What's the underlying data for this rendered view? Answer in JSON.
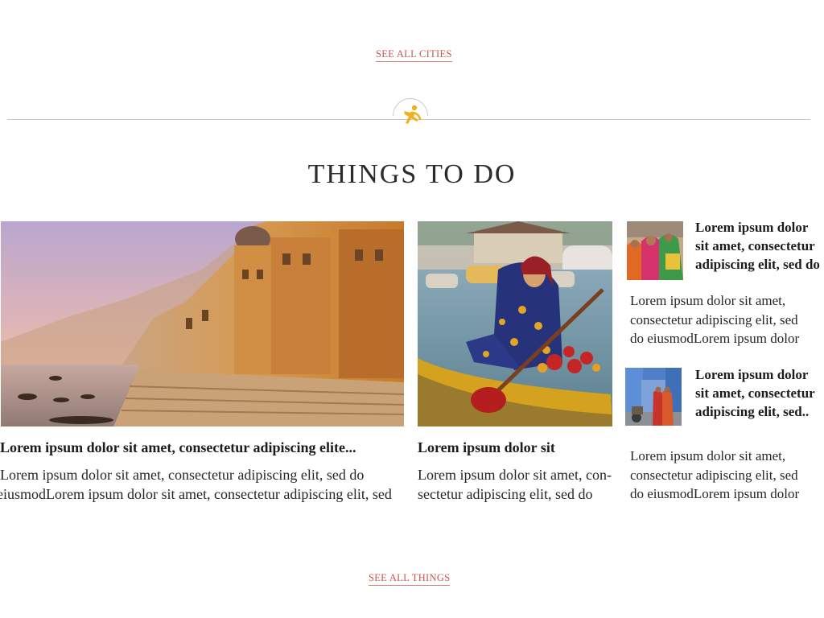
{
  "links": {
    "see_all_cities": "SEE ALL CITIES",
    "see_all_things": "SEE ALL THINGS"
  },
  "section": {
    "title": "THINGS TO DO",
    "emblem_icon": "runner-icon",
    "emblem_color": "#f2b01e"
  },
  "colors": {
    "link": "#c9574f",
    "divider": "#c8c8c8"
  },
  "cards": {
    "featured": {
      "image": "varanasi-ghats-photo",
      "title": "Lorem ipsum dolor sit amet, consectetur adipiscing elite...",
      "body_line1": "Lorem ipsum dolor sit amet, consectetur adipiscing elit, sed do",
      "body_line2": "eiusmodLorem ipsum dolor sit amet, consectetur adipiscing elit, sed"
    },
    "middle": {
      "image": "kashmir-boat-woman-photo",
      "title": "Lorem ipsum dolor sit",
      "body_line1": "Lorem ipsum dolor sit amet, con-",
      "body_line2": "sectetur adipiscing elit, sed do"
    },
    "side": [
      {
        "image": "festival-women-photo",
        "title": "Lorem ipsum dolor sit amet, consectetur adipiscing elit, sed do",
        "body_line1": "Lorem ipsum dolor sit amet,",
        "body_line2": "consectetur adipiscing elit, sed",
        "body_line3": "do eiusmodLorem ipsum dolor"
      },
      {
        "image": "blue-city-street-photo",
        "title": "Lorem ipsum dolor sit amet, consectetur adipiscing elit, sed..",
        "body_line1": "Lorem ipsum dolor sit amet,",
        "body_line2": "consectetur adipiscing elit, sed",
        "body_line3": "do eiusmodLorem ipsum dolor"
      }
    ]
  }
}
